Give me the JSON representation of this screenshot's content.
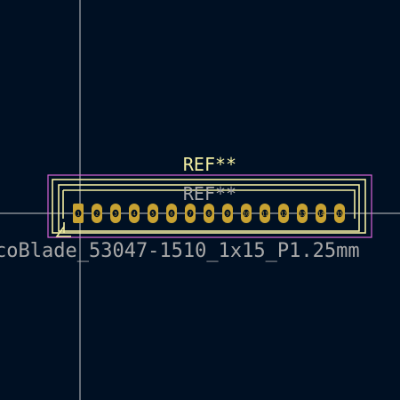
{
  "footprint": {
    "reference_silk": "REF**",
    "reference_fab": "REF**",
    "value": "coBlade_53047-1510_1x15_P1.25mm",
    "pin_count": 15,
    "pad_labels": [
      "1",
      "2",
      "3",
      "4",
      "5",
      "6",
      "7",
      "8",
      "9",
      "10",
      "11",
      "12",
      "13",
      "14",
      "15"
    ]
  },
  "colors": {
    "background": "#001023",
    "silkscreen": "#f2eda1",
    "courtyard": "#d864d8",
    "fab_text": "#a8a8a8",
    "pad_copper": "#c8a232",
    "drill_hole": "#001023",
    "crosshair": "#c8c8c8"
  },
  "icons": {
    "pin1_marker": "pin1-marker-icon",
    "cursor": "crosshair-cursor-icon"
  }
}
